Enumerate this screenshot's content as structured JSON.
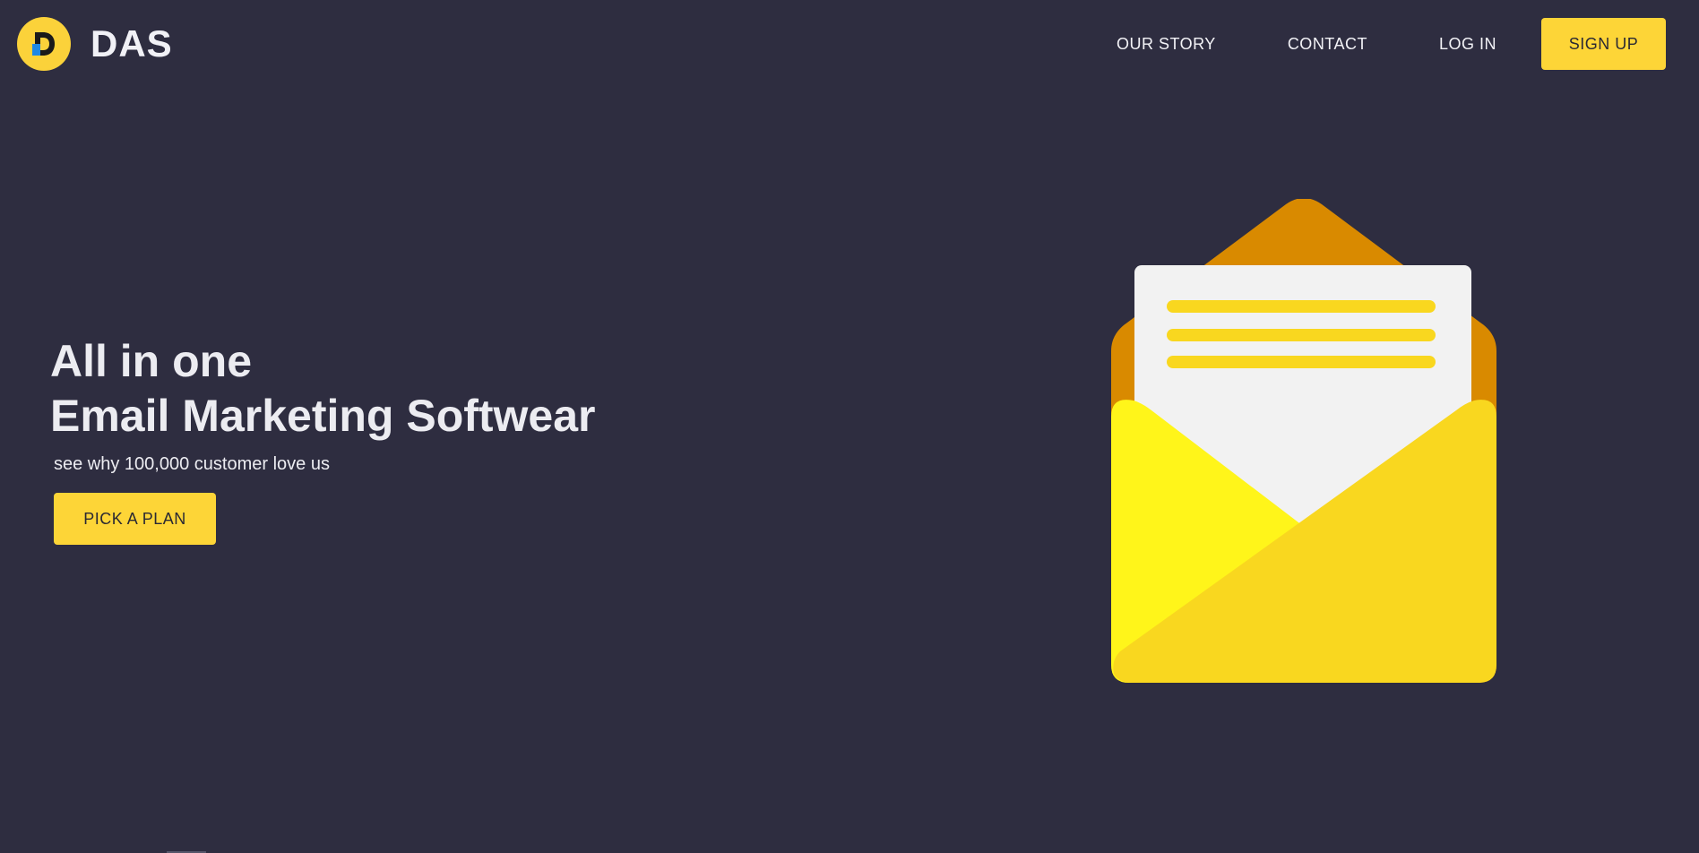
{
  "brand": {
    "logo_letter": "D",
    "name": "DAS"
  },
  "nav": {
    "links": [
      "OUR STORY",
      "CONTACT",
      "LOG IN"
    ],
    "signup_label": "SIGN UP"
  },
  "hero": {
    "title_line1": "All in one",
    "title_line2": "Email Marketing Softwear",
    "subtitle": "see why 100,000 customer love us",
    "cta_label": "PICK A PLAN"
  },
  "illustration": {
    "icon": "open-envelope-icon"
  },
  "colors": {
    "background": "#2e2d40",
    "accent": "#fdd537",
    "envelope_back": "#d98a00",
    "envelope_front": "#f9d71f",
    "envelope_left": "#fff51a",
    "letter": "#f2f2f2"
  }
}
